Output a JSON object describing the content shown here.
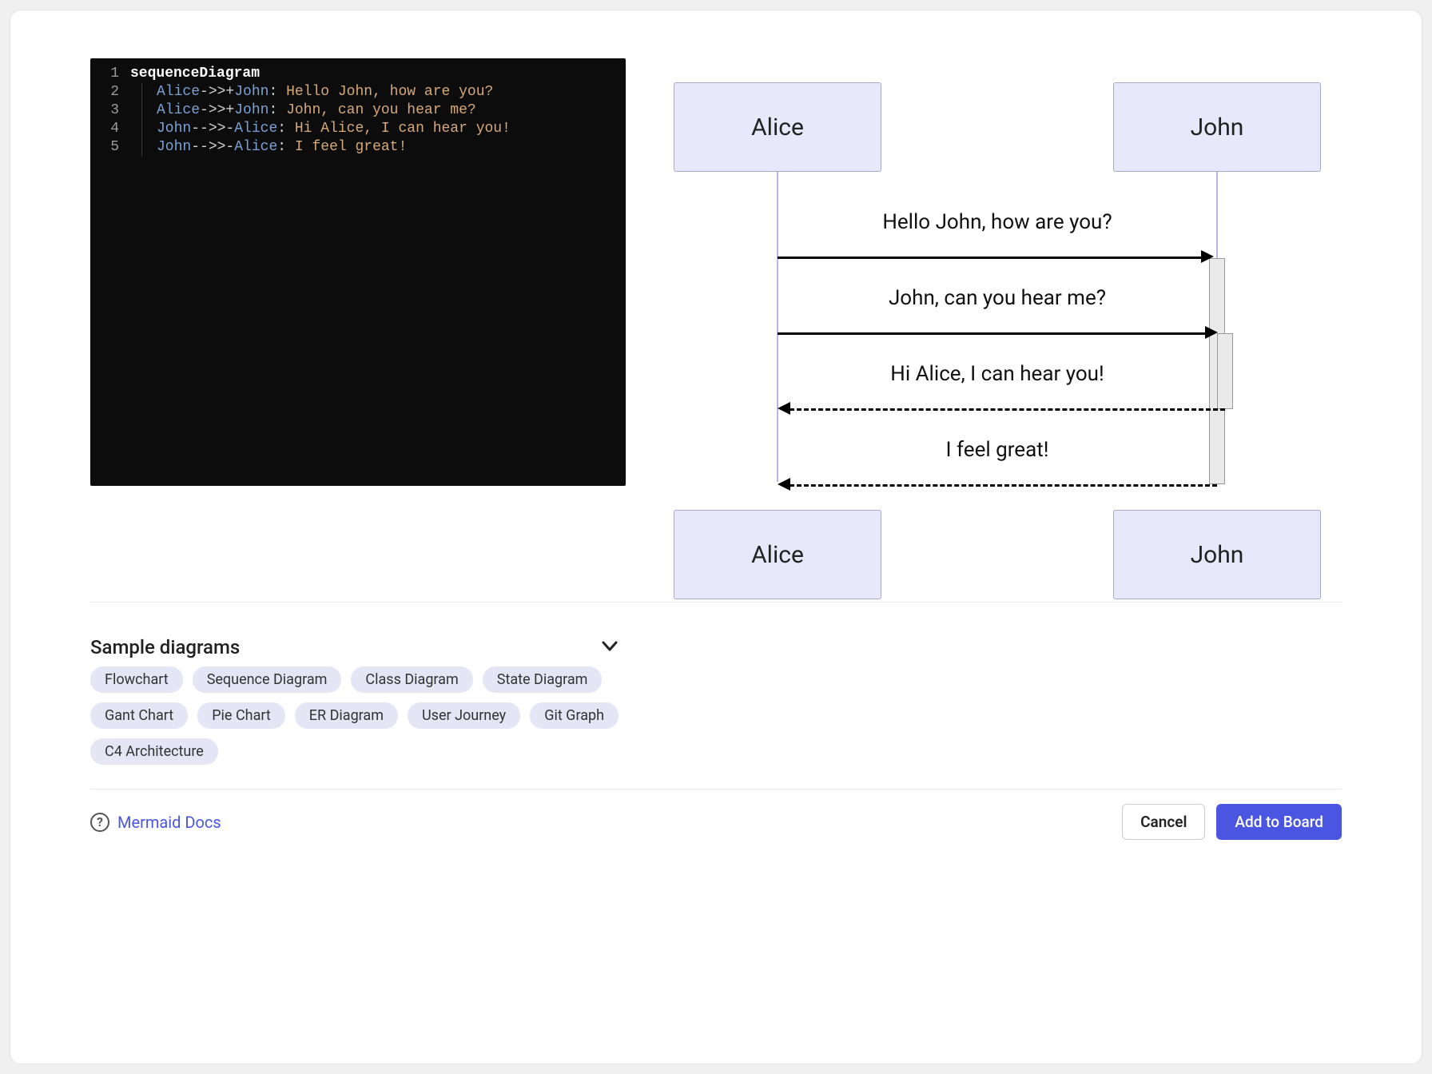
{
  "editor": {
    "lines": [
      {
        "num": "1",
        "indent": false,
        "tokens": [
          [
            "kw",
            "sequenceDiagram"
          ]
        ]
      },
      {
        "num": "2",
        "indent": true,
        "tokens": [
          [
            "actor",
            "Alice"
          ],
          [
            "op",
            "->>+"
          ],
          [
            "actor",
            "John"
          ],
          [
            "op",
            ": "
          ],
          [
            "msg",
            "Hello John, how are you?"
          ]
        ]
      },
      {
        "num": "3",
        "indent": true,
        "tokens": [
          [
            "actor",
            "Alice"
          ],
          [
            "op",
            "->>+"
          ],
          [
            "actor",
            "John"
          ],
          [
            "op",
            ": "
          ],
          [
            "msg",
            "John, can you hear me?"
          ]
        ]
      },
      {
        "num": "4",
        "indent": true,
        "tokens": [
          [
            "actor",
            "John"
          ],
          [
            "op",
            "-->>-"
          ],
          [
            "actor",
            "Alice"
          ],
          [
            "op",
            ": "
          ],
          [
            "msg",
            "Hi Alice, I can hear you!"
          ]
        ]
      },
      {
        "num": "5",
        "indent": true,
        "tokens": [
          [
            "actor",
            "John"
          ],
          [
            "op",
            "-->>-"
          ],
          [
            "actor",
            "Alice"
          ],
          [
            "op",
            ": "
          ],
          [
            "msg",
            "I feel great!"
          ]
        ]
      }
    ]
  },
  "diagram": {
    "actors": {
      "left": "Alice",
      "right": "John"
    },
    "messages": [
      {
        "text": "Hello John, how are you?",
        "dir": "r",
        "style": "solid"
      },
      {
        "text": "John, can you hear me?",
        "dir": "r",
        "style": "solid"
      },
      {
        "text": "Hi Alice, I can hear you!",
        "dir": "l",
        "style": "dashed"
      },
      {
        "text": "I feel great!",
        "dir": "l",
        "style": "dashed"
      }
    ]
  },
  "samples": {
    "title": "Sample diagrams",
    "chips": [
      "Flowchart",
      "Sequence Diagram",
      "Class Diagram",
      "State Diagram",
      "Gant Chart",
      "Pie Chart",
      "ER Diagram",
      "User Journey",
      "Git Graph",
      "C4 Architecture"
    ]
  },
  "footer": {
    "docs_label": "Mermaid Docs",
    "cancel_label": "Cancel",
    "add_label": "Add to Board"
  }
}
